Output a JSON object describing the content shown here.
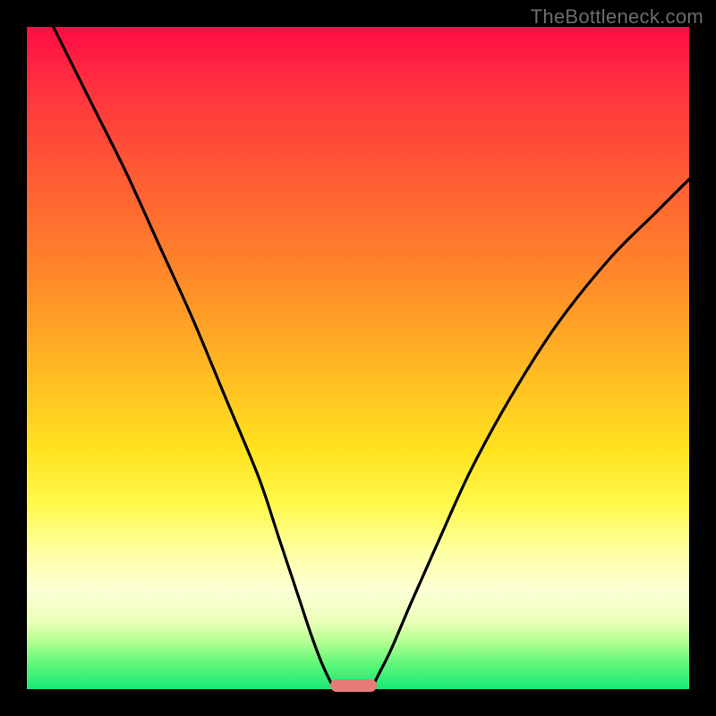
{
  "watermark": "TheBottleneck.com",
  "chart_data": {
    "type": "line",
    "title": "",
    "xlabel": "",
    "ylabel": "",
    "xlim": [
      0,
      100
    ],
    "ylim": [
      0,
      100
    ],
    "grid": false,
    "legend": false,
    "series": [
      {
        "name": "left-curve",
        "x": [
          4,
          10,
          15,
          20,
          25,
          30,
          35,
          38,
          41,
          43,
          44.5,
          45.8,
          46.5
        ],
        "y": [
          100,
          88,
          78,
          67,
          56,
          44,
          32,
          23,
          14,
          8,
          4,
          1.2,
          0
        ]
      },
      {
        "name": "right-curve",
        "x": [
          52,
          53,
          55,
          58,
          62,
          67,
          73,
          80,
          88,
          95,
          100
        ],
        "y": [
          0,
          2,
          6,
          13,
          22,
          33,
          44,
          55,
          65,
          72,
          77
        ]
      }
    ],
    "annotations": [
      {
        "name": "cusp-marker",
        "x_center": 49.3,
        "width_pct": 7.0,
        "y": 0
      }
    ],
    "background_gradient": {
      "top": "#ff0b45",
      "mid": "#ffe31f",
      "bottom": "#18e876"
    }
  }
}
